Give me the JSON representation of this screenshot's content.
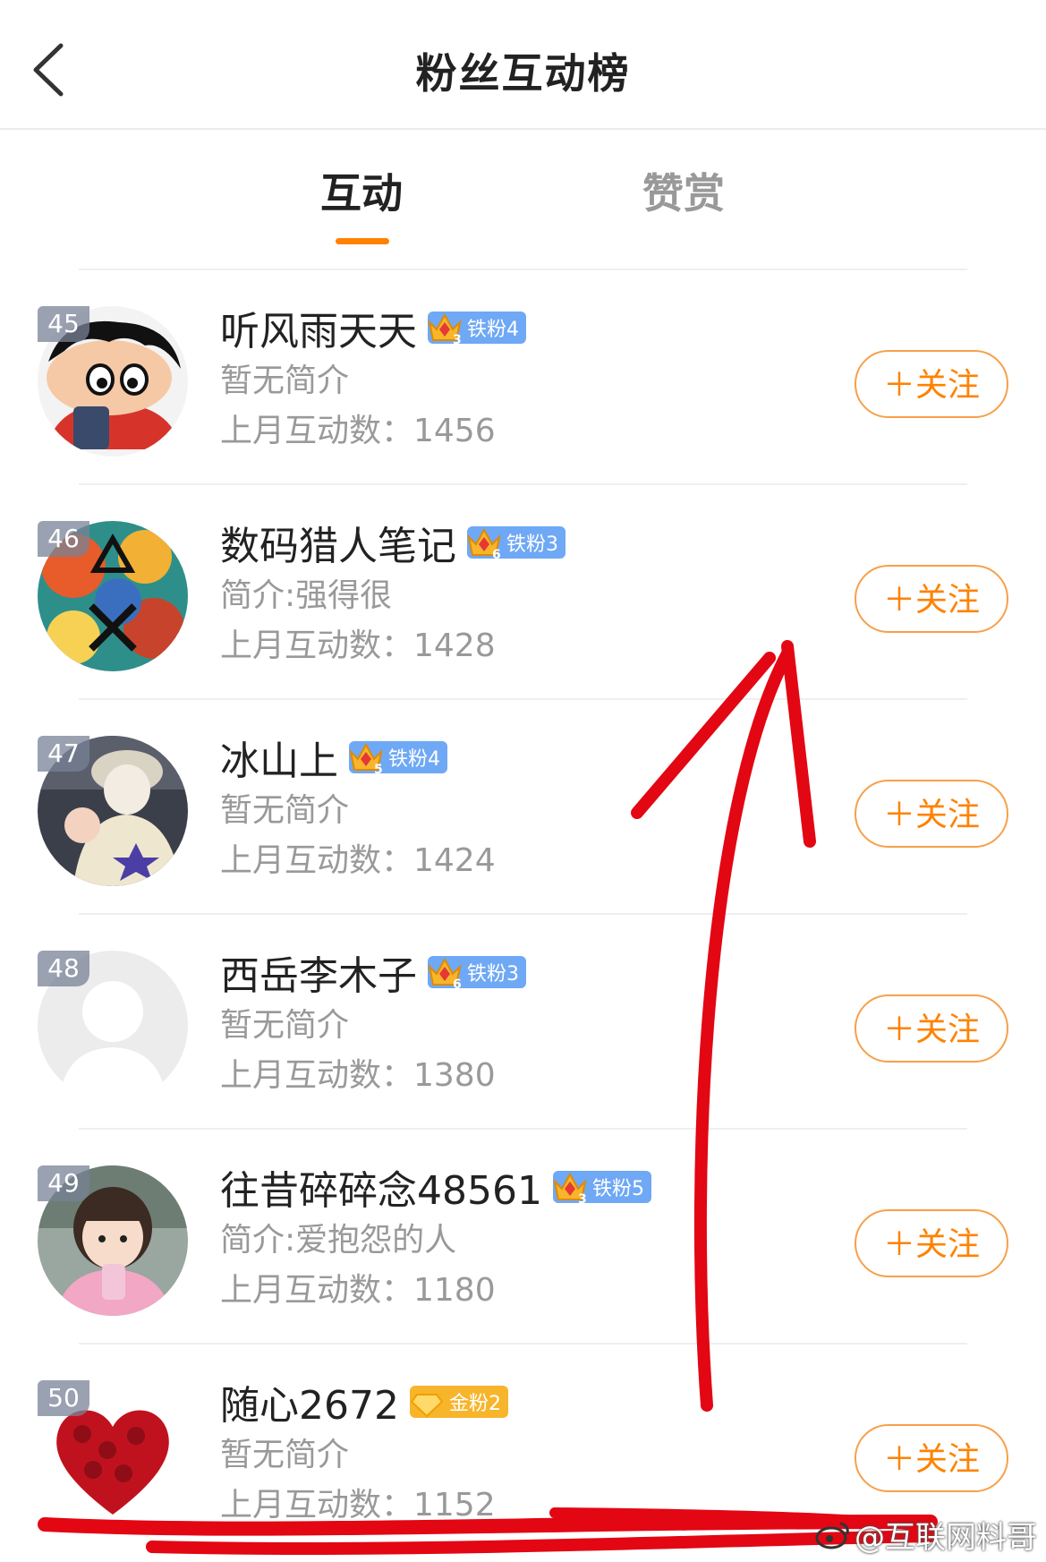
{
  "header": {
    "title": "粉丝互动榜"
  },
  "tabs": [
    {
      "label": "互动",
      "active": true
    },
    {
      "label": "赞赏",
      "active": false
    }
  ],
  "colors": {
    "accent": "#ff8200",
    "iron_badge": "#6fa8f5",
    "gold_badge": "#f7b52c",
    "annotation": "#e30613"
  },
  "rows": [
    {
      "rank": "45",
      "name": "听风雨天天",
      "badge_level": "3",
      "badge_text": "铁粉4",
      "badge_type": "iron",
      "bio": "暂无简介",
      "count": "上月互动数：1456",
      "follow": "＋关注"
    },
    {
      "rank": "46",
      "name": "数码猎人笔记",
      "badge_level": "6",
      "badge_text": "铁粉3",
      "badge_type": "iron",
      "bio": "简介:强得很",
      "count": "上月互动数：1428",
      "follow": "＋关注"
    },
    {
      "rank": "47",
      "name": "冰山上",
      "badge_level": "5",
      "badge_text": "铁粉4",
      "badge_type": "iron",
      "bio": "暂无简介",
      "count": "上月互动数：1424",
      "follow": "＋关注"
    },
    {
      "rank": "48",
      "name": "西岳李木子",
      "badge_level": "6",
      "badge_text": "铁粉3",
      "badge_type": "iron",
      "bio": "暂无简介",
      "count": "上月互动数：1380",
      "follow": "＋关注"
    },
    {
      "rank": "49",
      "name": "往昔碎碎念48561",
      "badge_level": "3",
      "badge_text": "铁粉5",
      "badge_type": "iron",
      "bio": "简介:爱抱怨的人",
      "count": "上月互动数：1180",
      "follow": "＋关注"
    },
    {
      "rank": "50",
      "name": "随心2672",
      "badge_level": "",
      "badge_text": "金粉2",
      "badge_type": "gold",
      "bio": "暂无简介",
      "count": "上月互动数：1152",
      "follow": "＋关注"
    }
  ],
  "watermark": "@互联网料哥"
}
